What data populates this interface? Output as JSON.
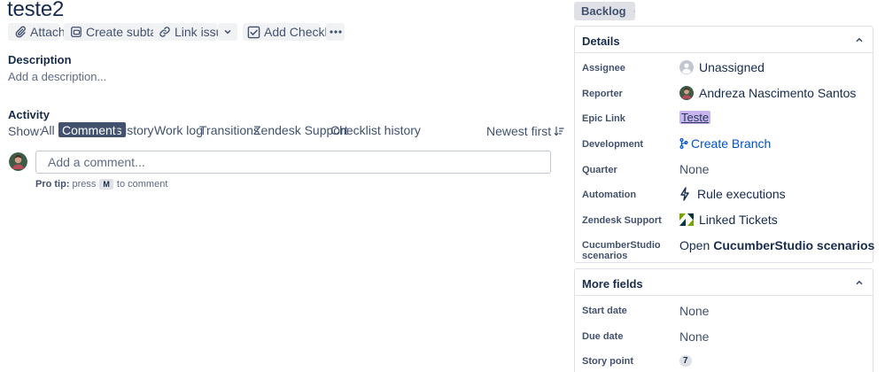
{
  "issue": {
    "title": "teste2"
  },
  "toolbar": {
    "attach_label": "Attach",
    "create_subtask_label": "Create subtask",
    "link_issue_label": "Link issue",
    "add_checklist_label": "Add Checklist"
  },
  "description": {
    "heading": "Description",
    "placeholder": "Add a description..."
  },
  "activity": {
    "heading": "Activity",
    "show_label": "Show:",
    "filters": [
      "All",
      "Comments",
      "History",
      "Work log",
      "Transitions",
      "Zendesk Support",
      "Checklist history"
    ],
    "active_filter": "Comments",
    "sort_label": "Newest first"
  },
  "comment": {
    "placeholder": "Add a comment...",
    "protip_label": "Pro tip:",
    "protip_press": "press",
    "protip_key": "M",
    "protip_suffix": "to comment"
  },
  "status": {
    "label": "Backlog"
  },
  "details": {
    "title": "Details",
    "assignee_label": "Assignee",
    "assignee_value": "Unassigned",
    "reporter_label": "Reporter",
    "reporter_value": "Andreza Nascimento Santos",
    "epic_label": "Epic Link",
    "epic_value": "Teste",
    "development_label": "Development",
    "development_value": "Create Branch",
    "quarter_label": "Quarter",
    "quarter_value": "None",
    "automation_label": "Automation",
    "automation_value": "Rule executions",
    "zendesk_label": "Zendesk Support",
    "zendesk_value": "Linked Tickets",
    "cucumber_label_line1": "CucumberStudio",
    "cucumber_label_line2": "scenarios",
    "cucumber_open": "Open",
    "cucumber_value": "CucumberStudio scenarios"
  },
  "more_fields": {
    "title": "More fields",
    "start_date_label": "Start date",
    "start_date_value": "None",
    "due_date_label": "Due date",
    "due_date_value": "None",
    "story_point_label": "Story point",
    "story_point_value": "7"
  },
  "icons": {
    "attach": "paperclip-icon",
    "subtask": "subtask-icon",
    "link": "link-icon",
    "checklist": "checkbox-icon",
    "more": "more-icon",
    "sort": "sort-icon",
    "chevron": "chevron-icon"
  }
}
